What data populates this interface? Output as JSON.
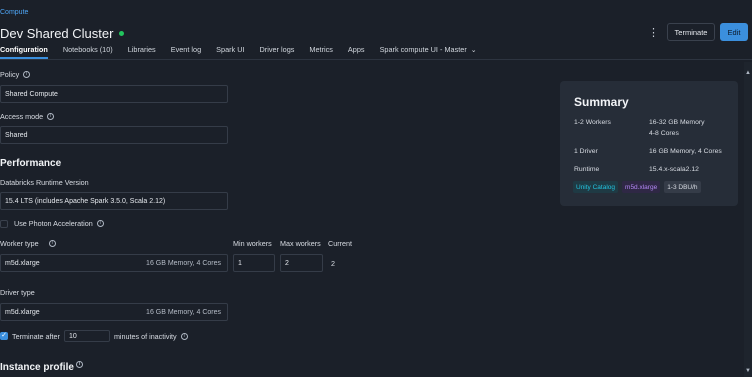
{
  "breadcrumb": "Compute",
  "title": "Dev Shared Cluster",
  "status_color": "#22c55e",
  "header": {
    "kebab_icon": "⋮",
    "terminate_label": "Terminate",
    "edit_label": "Edit"
  },
  "tabs": [
    {
      "label": "Configuration"
    },
    {
      "label": "Notebooks (10)"
    },
    {
      "label": "Libraries"
    },
    {
      "label": "Event log"
    },
    {
      "label": "Spark UI"
    },
    {
      "label": "Driver logs"
    },
    {
      "label": "Metrics"
    },
    {
      "label": "Apps"
    },
    {
      "label": "Spark compute UI - Master"
    }
  ],
  "policy": {
    "label": "Policy",
    "value": "Shared Compute"
  },
  "access_mode": {
    "label": "Access mode",
    "value": "Shared"
  },
  "performance": {
    "heading": "Performance",
    "runtime_label": "Databricks Runtime Version",
    "runtime_value": "15.4 LTS (includes Apache Spark 3.5.0, Scala 2.12)",
    "photon_label": "Use Photon Acceleration",
    "worker_type_label": "Worker type",
    "worker_type_value": "m5d.xlarge",
    "worker_type_meta": "16 GB Memory, 4 Cores",
    "min_workers_label": "Min workers",
    "min_workers_value": "1",
    "max_workers_label": "Max workers",
    "max_workers_value": "2",
    "current_label": "Current",
    "current_value": "2",
    "driver_type_label": "Driver type",
    "driver_type_value": "m5d.xlarge",
    "driver_type_meta": "16 GB Memory, 4 Cores",
    "terminate_prefix": "Terminate after",
    "terminate_value": "10",
    "terminate_suffix": "minutes of inactivity"
  },
  "instance_profile": {
    "heading": "Instance profile"
  },
  "summary": {
    "title": "Summary",
    "workers_label": "1-2 Workers",
    "workers_detail_1": "16-32 GB Memory",
    "workers_detail_2": "4-8 Cores",
    "driver_label": "1 Driver",
    "driver_detail": "16 GB Memory, 4 Cores",
    "runtime_label": "Runtime",
    "runtime_detail": "15.4.x-scala2.12",
    "chips": [
      {
        "label": "Unity Catalog",
        "color": "#22c4e0",
        "bg": "#1f3a44"
      },
      {
        "label": "m5d.xlarge",
        "color": "#b387f5",
        "bg": "#2f2845"
      },
      {
        "label": "1-3 DBU/h",
        "color": "#d8dce3",
        "bg": "#353c48"
      }
    ]
  }
}
